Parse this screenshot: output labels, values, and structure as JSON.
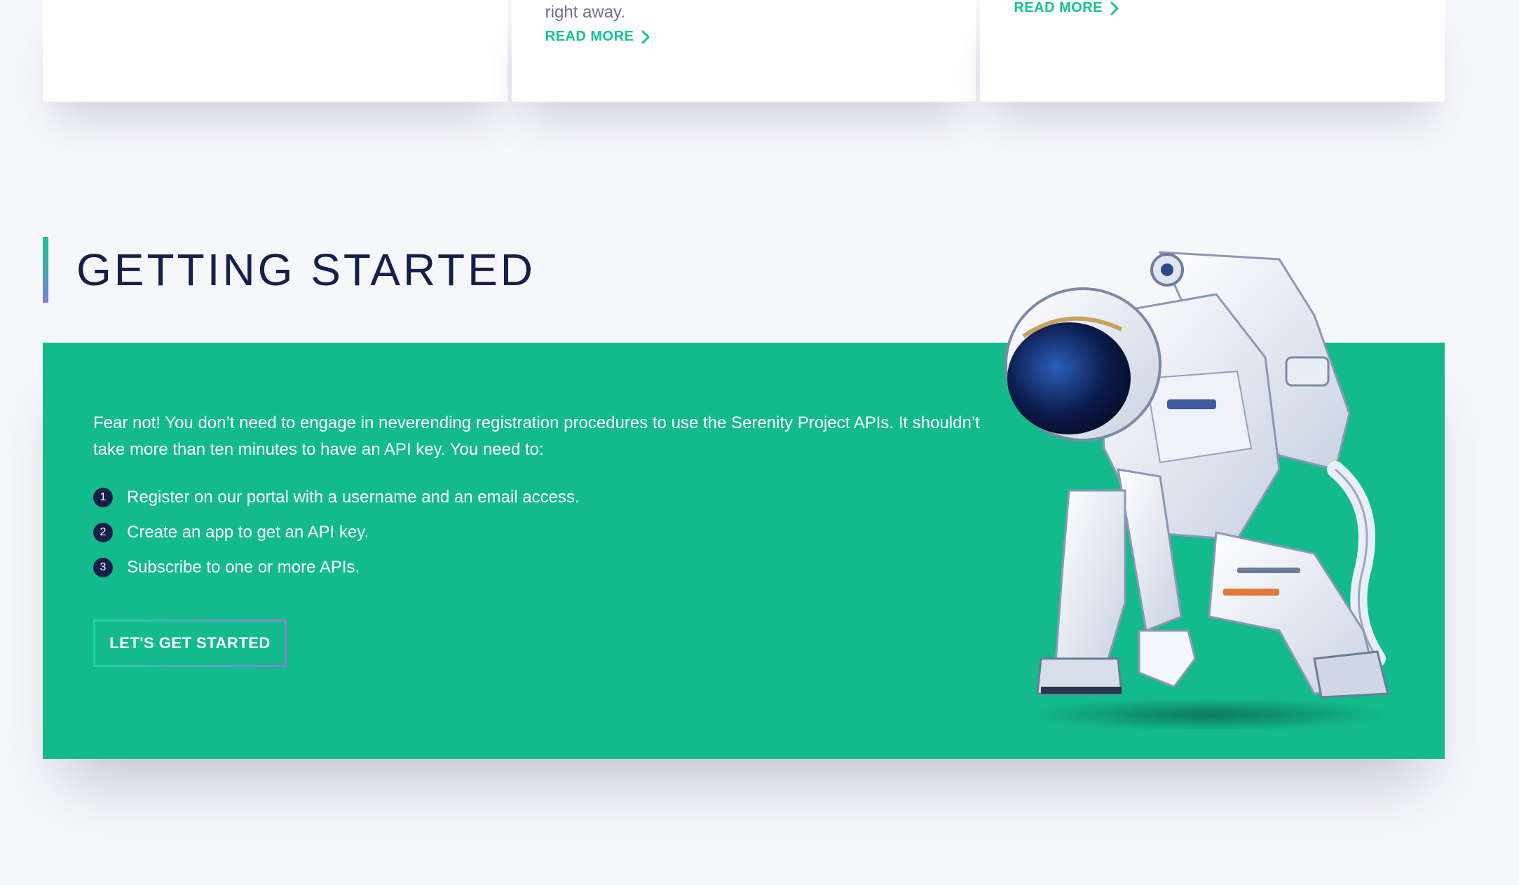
{
  "cards": [
    {
      "text": "",
      "read_more": ""
    },
    {
      "text": "right away.",
      "read_more": "READ MORE"
    },
    {
      "text": "",
      "read_more": "READ MORE"
    }
  ],
  "section": {
    "title": "GETTING STARTED",
    "intro": "Fear not! You don’t need to engage in neverending registration procedures to use the Serenity Project APIs. It shouldn’t take more than ten minutes to have an API key. You need to:",
    "steps": [
      {
        "number": "1",
        "text": "Register on our portal with a username and an email access."
      },
      {
        "number": "2",
        "text": "Create an app to get an API key."
      },
      {
        "number": "3",
        "text": "Subscribe to one or more APIs."
      }
    ],
    "cta_label": "LET'S GET STARTED"
  },
  "colors": {
    "brand_green": "#13ba8c",
    "link_green": "#14c492",
    "navy": "#15204a",
    "page_bg": "#f6f7fb"
  },
  "icons": {
    "read_more": "chevron-right-icon",
    "illustration": "astronaut-illustration"
  }
}
